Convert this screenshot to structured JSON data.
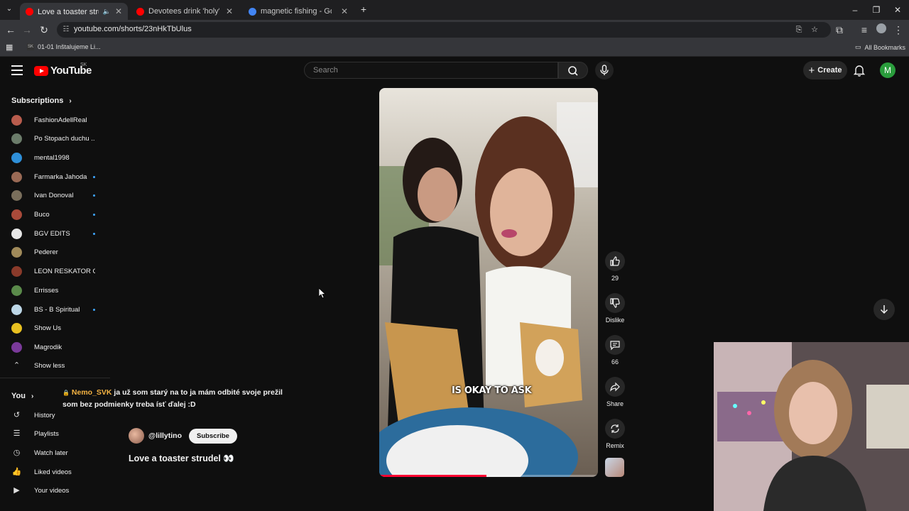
{
  "browser": {
    "tabs": [
      {
        "title": "Love a toaster strudel 👀 - ",
        "favicon_color": "#ff0000",
        "active": true
      },
      {
        "title": "Devotees drink 'holy' AC water",
        "favicon_color": "#ff0000",
        "active": false
      },
      {
        "title": "magnetic fishing - Google Sear",
        "favicon_color": "#4285f4",
        "active": false
      }
    ],
    "url": "youtube.com/shorts/23nHkTbUlus",
    "bookmarks": {
      "item": "01-01 Inštalujeme Li...",
      "all": "All Bookmarks"
    }
  },
  "header": {
    "logo_text": "YouTube",
    "country_code": "SK",
    "search_placeholder": "Search",
    "create_label": "Create",
    "avatar_letter": "M"
  },
  "sidebar": {
    "subscriptions_title": "Subscriptions",
    "subscriptions": [
      {
        "name": "FashionAdellReal",
        "color": "#b85c4d",
        "dot": false
      },
      {
        "name": "Po Stopach duchu ...",
        "color": "#6b7c6a",
        "dot": false
      },
      {
        "name": "mental1998",
        "color": "#2e8fd8",
        "dot": false
      },
      {
        "name": "Farmarka Jahoda",
        "color": "#9a6a55",
        "dot": true
      },
      {
        "name": "Ivan Donoval",
        "color": "#7a6f5c",
        "dot": true
      },
      {
        "name": "Buco",
        "color": "#a84a3a",
        "dot": true
      },
      {
        "name": "BGV EDITS",
        "color": "#e6e6e6",
        "dot": true
      },
      {
        "name": "Pederer",
        "color": "#a08a5a",
        "dot": false
      },
      {
        "name": "LEON RESKATOR O...",
        "color": "#8a3a2a",
        "dot": false
      },
      {
        "name": "Errisses",
        "color": "#5a8a4a",
        "dot": false
      },
      {
        "name": "BS - B Spiritual",
        "color": "#bcd6e6",
        "dot": true
      },
      {
        "name": "Show Us",
        "color": "#e8c020",
        "dot": false
      },
      {
        "name": "Magrodik",
        "color": "#7a3a9a",
        "dot": false
      }
    ],
    "show_less": "Show less",
    "you_title": "You",
    "you_items": [
      {
        "label": "History",
        "icon": "history-icon"
      },
      {
        "label": "Playlists",
        "icon": "playlists-icon"
      },
      {
        "label": "Watch later",
        "icon": "watch-later-icon"
      },
      {
        "label": "Liked videos",
        "icon": "liked-videos-icon"
      },
      {
        "label": "Your videos",
        "icon": "your-videos-icon"
      }
    ]
  },
  "chat": {
    "user": "Nemo_SVK",
    "message": "ja už som starý na to ja mám odbité svoje prežil som bez podmienky treba ísť ďalej :D"
  },
  "short": {
    "channel": "@lillytino",
    "subscribe_label": "Subscribe",
    "title": "Love a toaster strudel 👀",
    "caption": "IS OKAY TO ASK",
    "progress": 0.49
  },
  "actions": {
    "likes": "29",
    "dislike_label": "Dislike",
    "comments": "66",
    "share_label": "Share",
    "remix_label": "Remix"
  }
}
